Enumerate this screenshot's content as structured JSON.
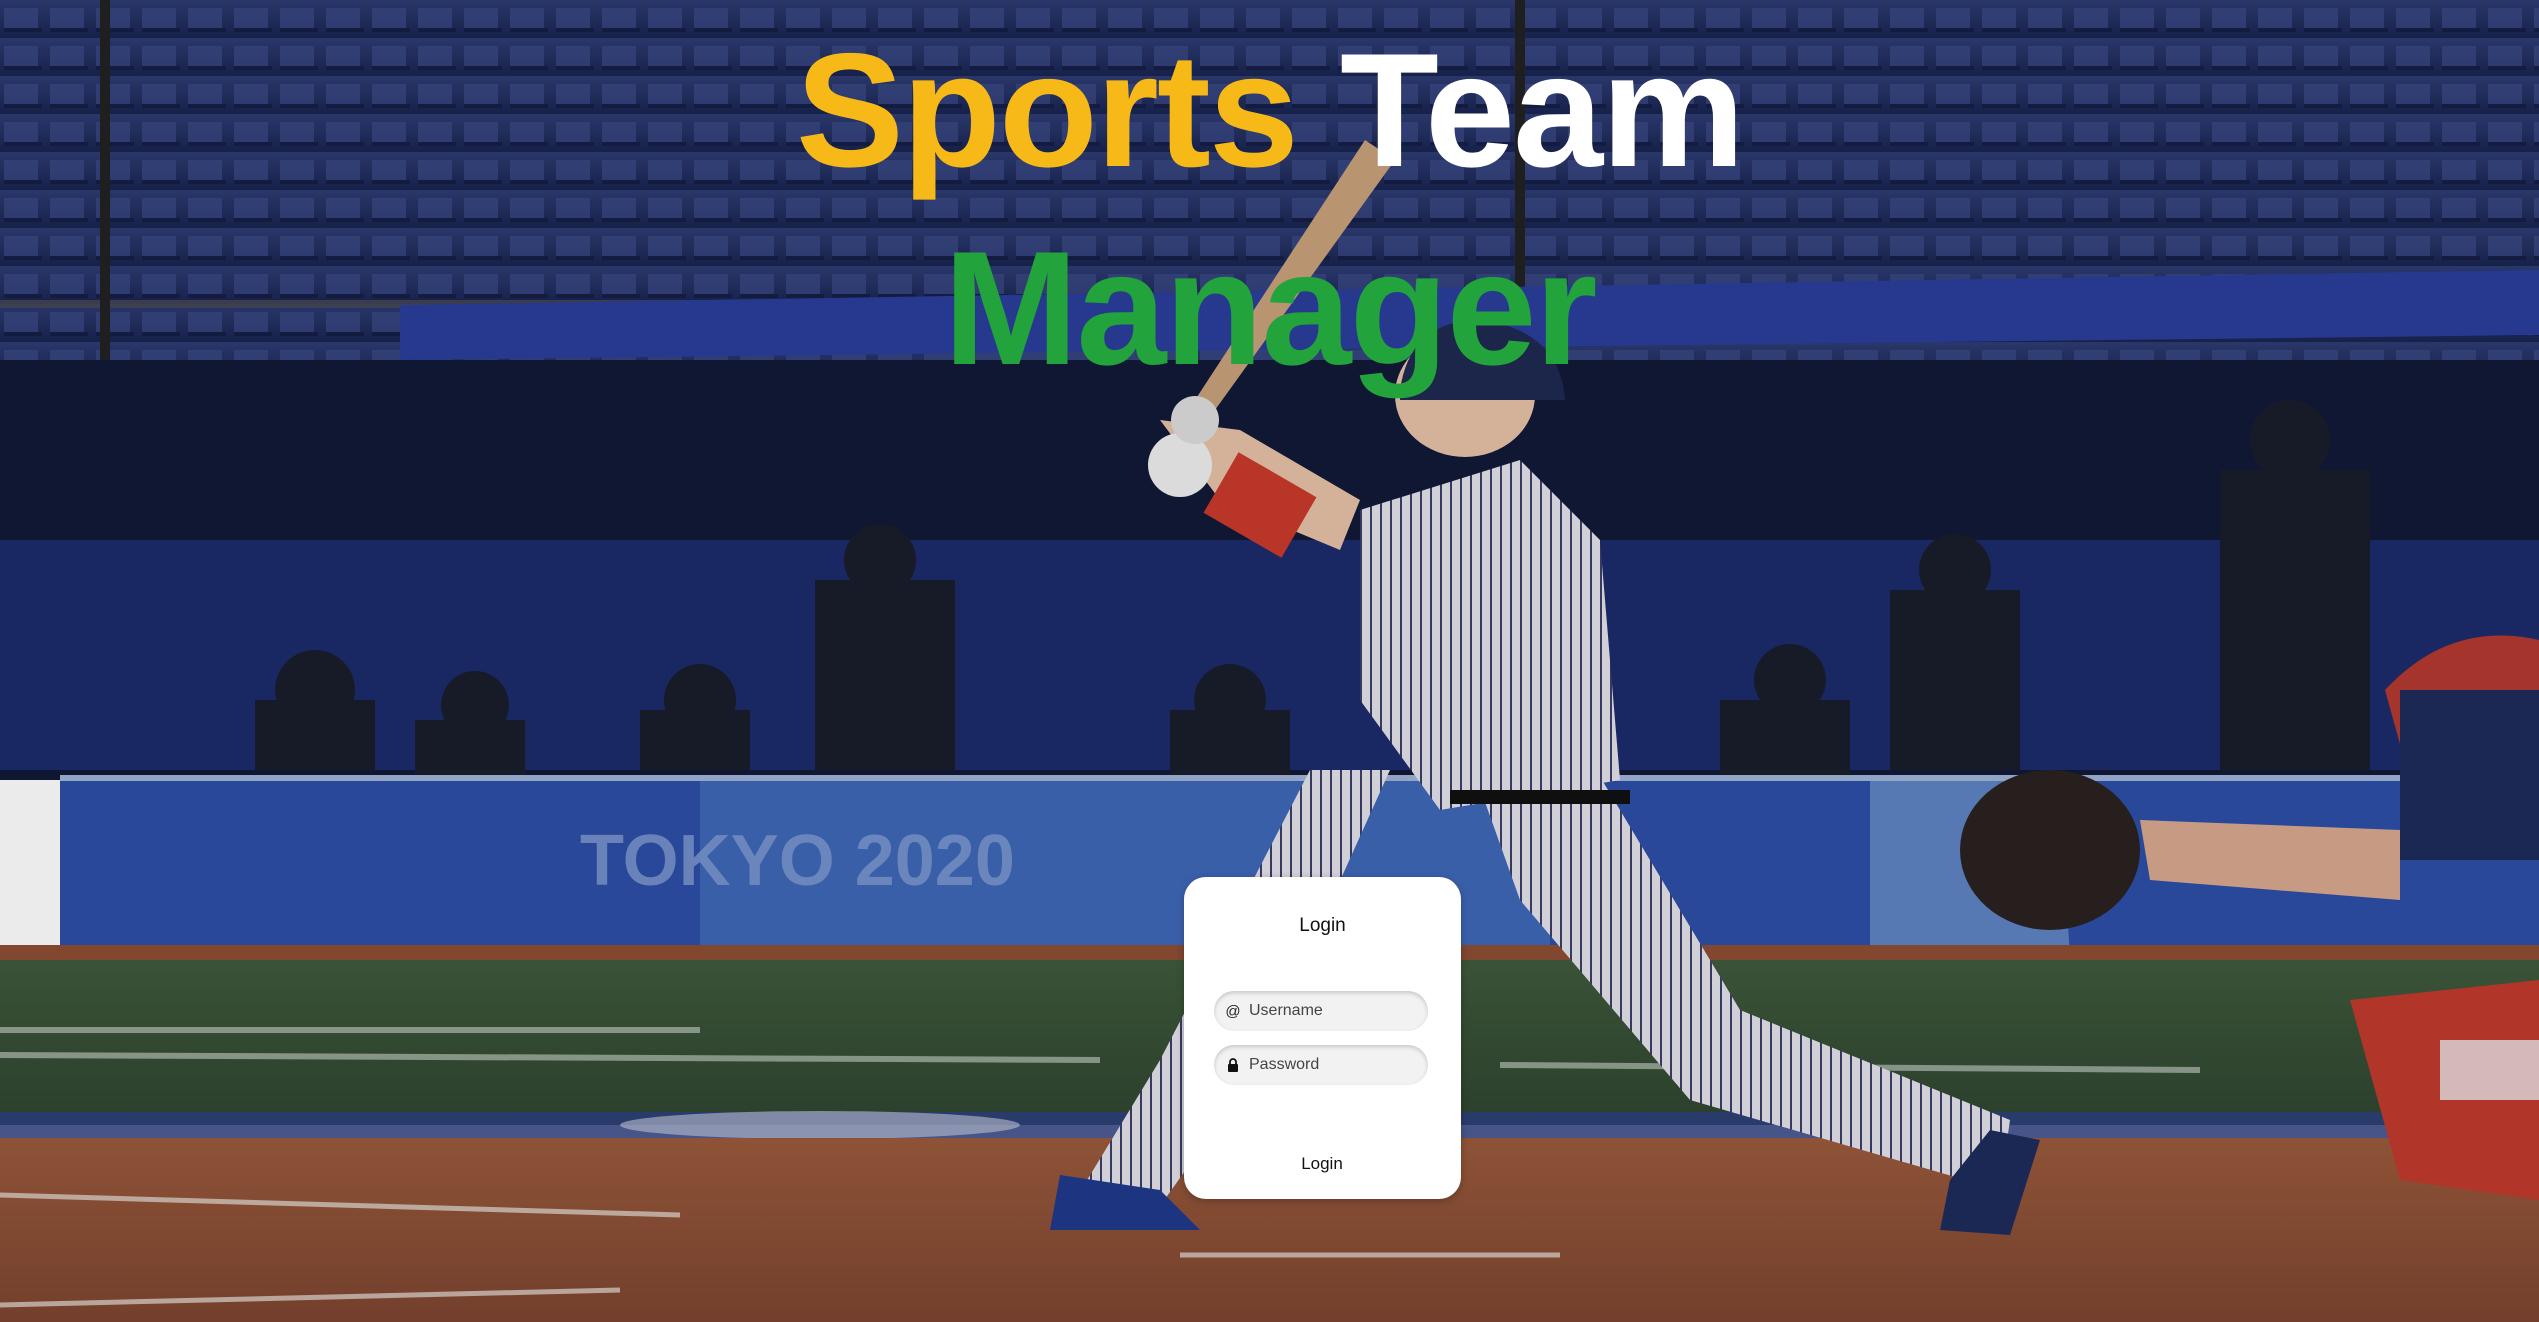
{
  "headline": {
    "word1": "Sports",
    "word2": "Team",
    "word3": "Manager"
  },
  "colors": {
    "word1": "#f7b917",
    "word2": "#ffffff",
    "word3": "#23a33b"
  },
  "background": {
    "banner_text": "TOKYO 2020"
  },
  "login": {
    "title": "Login",
    "username_placeholder": "Username",
    "username_value": "",
    "username_icon": "at-icon",
    "password_placeholder": "Password",
    "password_value": "",
    "password_icon": "lock-icon",
    "button_label": "Login"
  }
}
